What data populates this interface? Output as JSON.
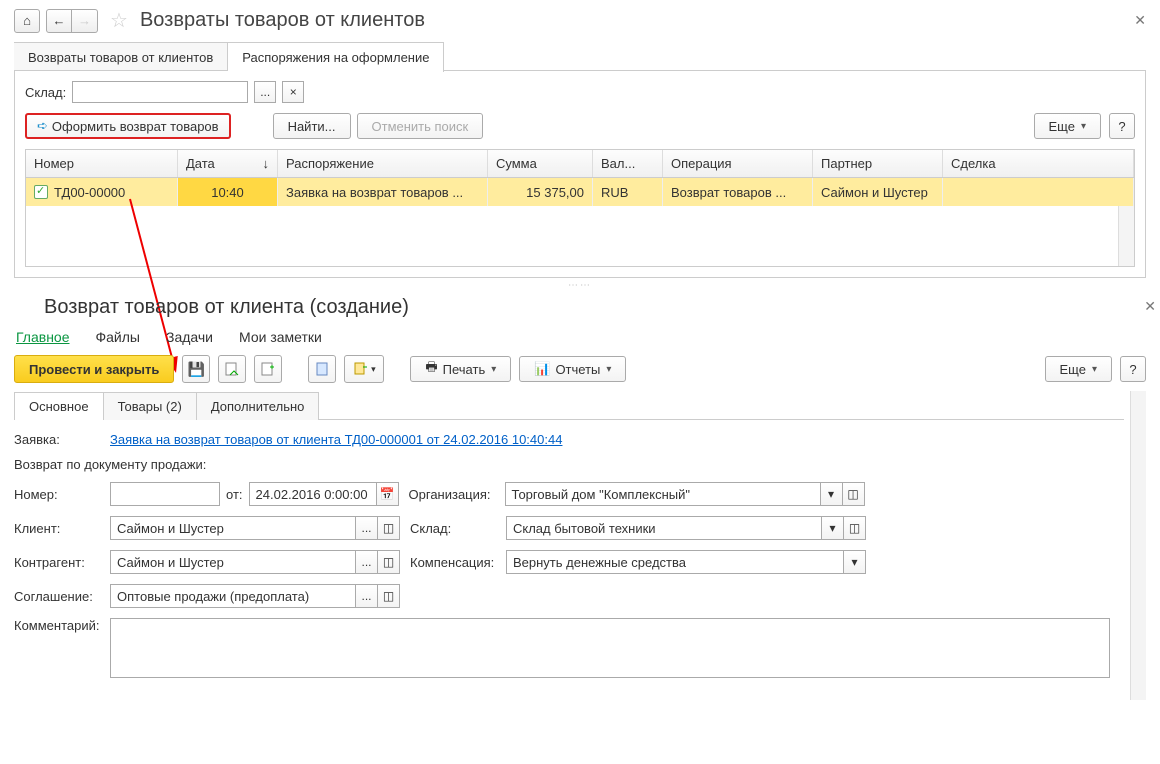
{
  "top": {
    "title": "Возвраты товаров от клиентов",
    "tabs": [
      "Возвраты товаров от клиентов",
      "Распоряжения на оформление"
    ],
    "active_tab": 1,
    "warehouse_label": "Склад:",
    "btn_create_return": "Оформить возврат товаров",
    "btn_find": "Найти...",
    "btn_cancel_search": "Отменить поиск",
    "btn_more": "Еще",
    "btn_help": "?",
    "columns": {
      "number": "Номер",
      "date": "Дата",
      "order": "Распоряжение",
      "sum": "Сумма",
      "currency": "Вал...",
      "operation": "Операция",
      "partner": "Партнер",
      "deal": "Сделка"
    },
    "rows": [
      {
        "number": "ТД00-00000",
        "date": "10:40",
        "order": "Заявка на возврат товаров ...",
        "sum": "15 375,00",
        "currency": "RUB",
        "operation": "Возврат товаров ...",
        "partner": "Саймон и Шустер",
        "deal": ""
      }
    ]
  },
  "bottom": {
    "title": "Возврат товаров от клиента (создание)",
    "navtabs": [
      "Главное",
      "Файлы",
      "Задачи",
      "Мои заметки"
    ],
    "active_nav": 0,
    "btn_post_close": "Провести и закрыть",
    "btn_print": "Печать",
    "btn_reports": "Отчеты",
    "btn_more": "Еще",
    "btn_help": "?",
    "ftabs": [
      "Основное",
      "Товары (2)",
      "Дополнительно"
    ],
    "active_ftab": 0,
    "fields": {
      "request_label": "Заявка:",
      "request_link": "Заявка на возврат товаров от клиента ТД00-000001 от 24.02.2016 10:40:44",
      "return_by_doc": "Возврат по документу продажи:",
      "number_label": "Номер:",
      "number_value": "",
      "from_label": "от:",
      "date_value": "24.02.2016  0:00:00",
      "org_label": "Организация:",
      "org_value": "Торговый дом \"Комплексный\"",
      "client_label": "Клиент:",
      "client_value": "Саймон и Шустер",
      "warehouse_label": "Склад:",
      "warehouse_value": "Склад бытовой техники",
      "contragent_label": "Контрагент:",
      "contragent_value": "Саймон и Шустер",
      "compensation_label": "Компенсация:",
      "compensation_value": "Вернуть денежные средства",
      "agreement_label": "Соглашение:",
      "agreement_value": "Оптовые продажи (предоплата)",
      "comment_label": "Комментарий:"
    }
  }
}
